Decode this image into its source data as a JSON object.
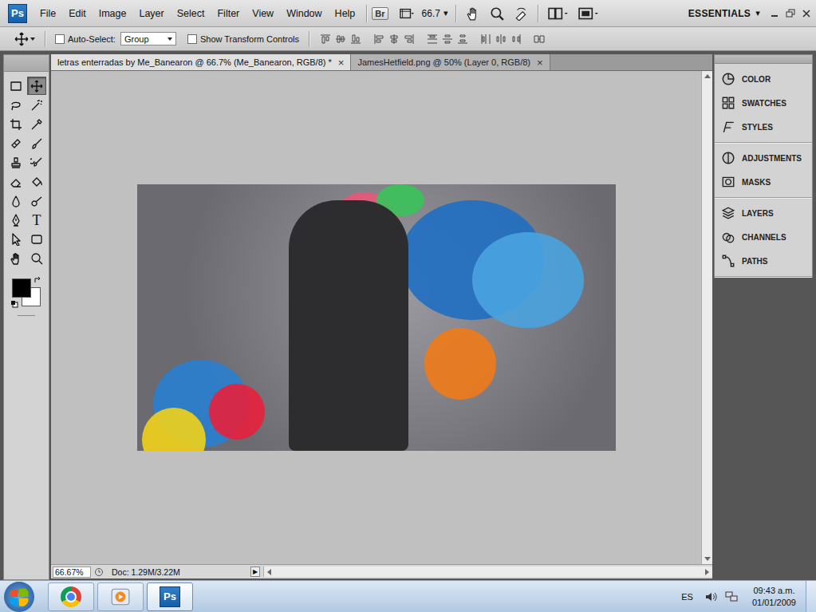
{
  "appbar": {
    "logo": "Ps",
    "menu": [
      "File",
      "Edit",
      "Image",
      "Layer",
      "Select",
      "Filter",
      "View",
      "Window",
      "Help"
    ],
    "bridge": "Br",
    "zoom": "66.7",
    "zoom_arrow": "▾",
    "workspace": "ESSENTIALS",
    "workspace_arrow": "▾"
  },
  "options": {
    "auto_select": {
      "label": "Auto-Select:",
      "checked": false
    },
    "auto_select_target": "Group",
    "transform_controls": {
      "label": "Show Transform Controls",
      "checked": false
    }
  },
  "tabs": [
    {
      "label": "letras enterradas by Me_Banearon @ 66.7% (Me_Banearon, RGB/8) *",
      "close": "×",
      "selected": true
    },
    {
      "label": "JamesHetfield.png @ 50% (Layer 0, RGB/8)",
      "close": "×",
      "selected": false
    }
  ],
  "tools": [
    {
      "selected": false
    },
    {
      "selected": true
    },
    {
      "selected": false
    },
    {
      "selected": false
    },
    {
      "selected": false
    },
    {
      "selected": false
    },
    {
      "selected": false
    },
    {
      "selected": false
    },
    {
      "selected": false
    },
    {
      "selected": false
    },
    {
      "selected": false
    },
    {
      "selected": false
    },
    {
      "selected": false
    },
    {
      "selected": false
    },
    {
      "selected": false
    },
    {
      "selected": false,
      "glyph": "T"
    },
    {
      "selected": false
    },
    {
      "selected": false
    },
    {
      "selected": false
    },
    {
      "selected": false
    }
  ],
  "colors": {
    "foreground": "#000000",
    "background": "#ffffff"
  },
  "panels": [
    [
      {
        "label": "COLOR"
      },
      {
        "label": "SWATCHES"
      },
      {
        "label": "STYLES"
      }
    ],
    [
      {
        "label": "ADJUSTMENTS"
      },
      {
        "label": "MASKS"
      }
    ],
    [
      {
        "label": "LAYERS"
      },
      {
        "label": "CHANNELS"
      },
      {
        "label": "PATHS"
      }
    ]
  ],
  "status": {
    "zoom": "66.67%",
    "doc": "Doc: 1.29M/3.22M",
    "menu_arrow": "▶"
  },
  "taskbar": {
    "apps": [
      {
        "label": "",
        "selected": false
      },
      {
        "label": "",
        "selected": false
      },
      {
        "label": "Ps",
        "selected": true
      }
    ],
    "language": "ES",
    "time": "09:43 a.m.",
    "date": "01/01/2009"
  }
}
